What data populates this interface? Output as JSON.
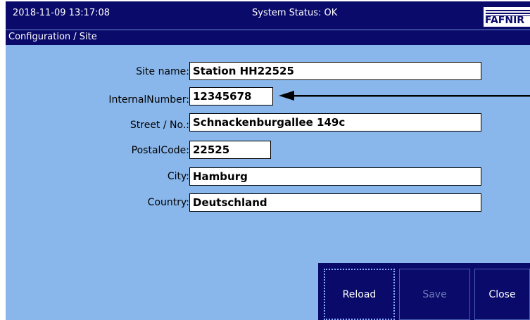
{
  "topbar": {
    "datetime": "2018-11-09  13:17:08",
    "status": "System Status: OK",
    "logo_text": "FAFNIR"
  },
  "breadcrumb": "Configuration / Site",
  "form": {
    "site_name": {
      "label": "Site name:",
      "value": "Station HH22525"
    },
    "internal_number": {
      "label": "InternalNumber:",
      "value": "12345678"
    },
    "street": {
      "label": "Street / No.:",
      "value": "Schnackenburgallee 149c"
    },
    "postal_code": {
      "label": "PostalCode:",
      "value": "22525"
    },
    "city": {
      "label": "City:",
      "value": "Hamburg"
    },
    "country": {
      "label": "Country:",
      "value": "Deutschland"
    }
  },
  "buttons": {
    "reload": "Reload",
    "save": "Save",
    "close": "Close"
  },
  "colors": {
    "background": "#8ab7eb",
    "bar": "#0a0a6b",
    "disabled_text": "#6d7db3"
  },
  "icons": {
    "annotation": "arrow-left-icon",
    "logo": "fafnir-logo"
  }
}
